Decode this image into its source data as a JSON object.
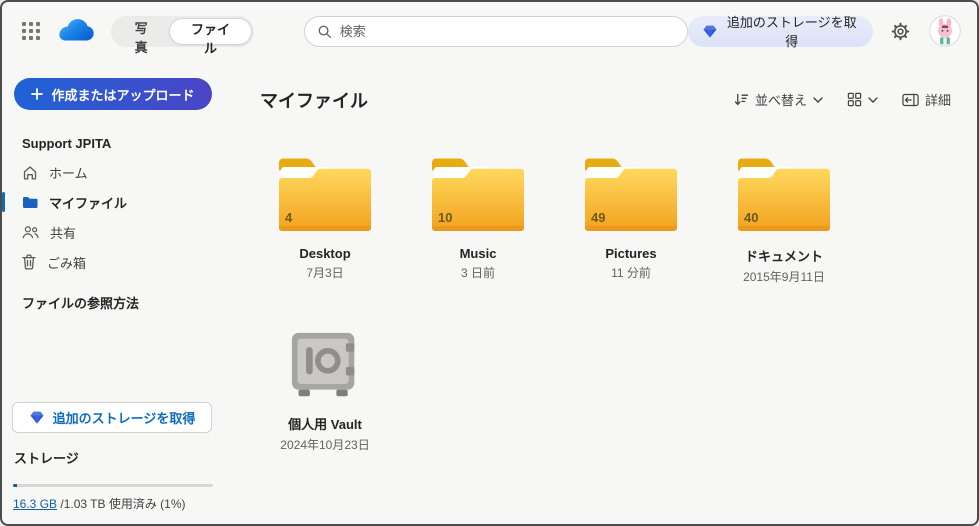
{
  "theme": {
    "accent": "#0f6cbd",
    "link_color": "#115ea3",
    "create_gradient": [
      "#1f63d6",
      "#4a45c6"
    ],
    "folder_gradient": [
      "#ffd95e",
      "#f2a21e"
    ],
    "storage_pill_bg": [
      "#e9ecfa",
      "#dce2f7"
    ]
  },
  "topbar": {
    "tabs": {
      "photos": "写真",
      "files": "ファイル",
      "selected": "ファイル"
    },
    "search": {
      "placeholder": "検索"
    },
    "get_storage_label": "追加のストレージを取得"
  },
  "sidebar": {
    "create_button": "作成またはアップロード",
    "account_name": "Support JPITA",
    "nav": [
      {
        "label": "ホーム",
        "selected": false
      },
      {
        "label": "マイファイル",
        "selected": true
      },
      {
        "label": "共有",
        "selected": false
      },
      {
        "label": "ごみ箱",
        "selected": false
      }
    ],
    "browse_heading": "ファイルの参照方法",
    "get_storage_button": "追加のストレージを取得",
    "storage_heading": "ストレージ",
    "usage": {
      "used_link": "16.3 GB",
      "rest": "/1.03 TB 使用済み (1%)",
      "percent_used": 1
    }
  },
  "main": {
    "title": "マイファイル",
    "toolbar": {
      "sort_label": "並べ替え",
      "details_label": "詳細"
    },
    "folders": [
      {
        "name": "Desktop",
        "count": "4",
        "date": "7月3日"
      },
      {
        "name": "Music",
        "count": "10",
        "date": "3 日前"
      },
      {
        "name": "Pictures",
        "count": "49",
        "date": "11 分前"
      },
      {
        "name": "ドキュメント",
        "count": "40",
        "date": "2015年9月11日"
      }
    ],
    "vault": {
      "name": "個人用 Vault",
      "date": "2024年10月23日"
    }
  }
}
